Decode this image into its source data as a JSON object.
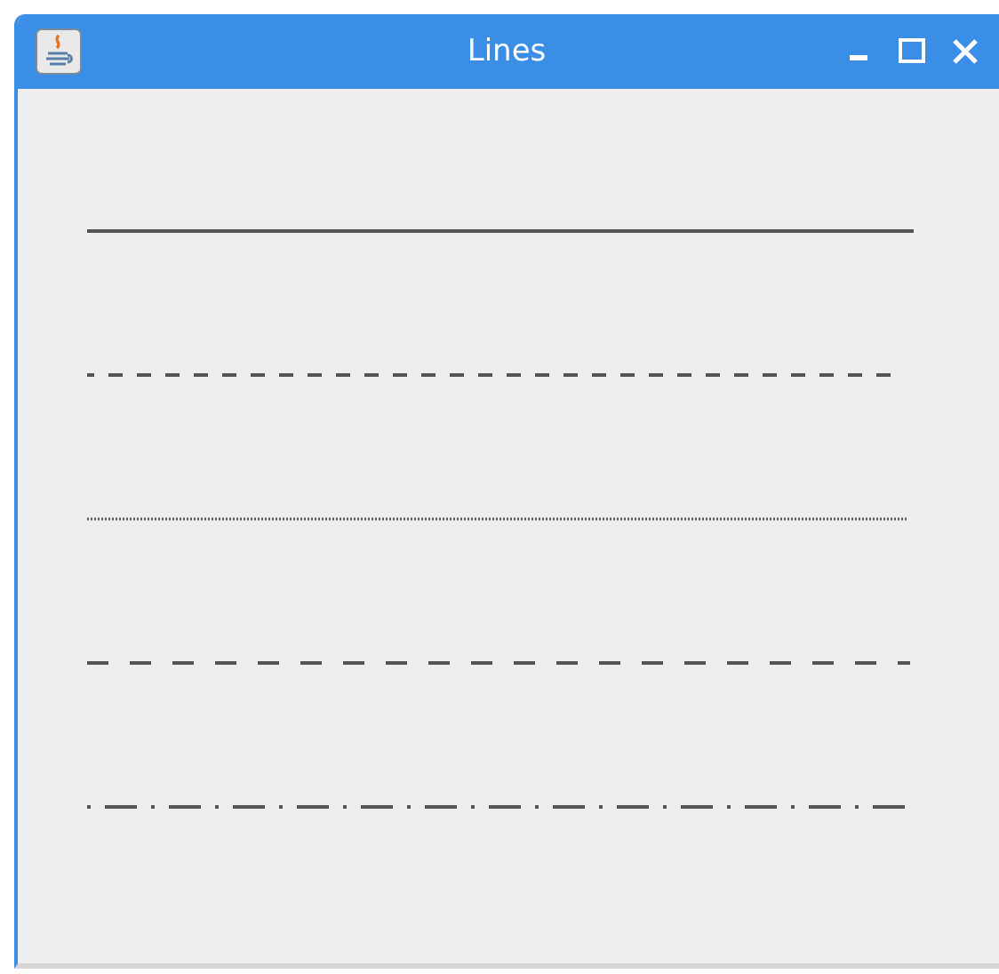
{
  "window": {
    "title": "Lines"
  },
  "lines": [
    {
      "kind": "solid"
    },
    {
      "kind": "dashed"
    },
    {
      "kind": "dotted"
    },
    {
      "kind": "long-dashed"
    },
    {
      "kind": "dash-dot"
    }
  ]
}
